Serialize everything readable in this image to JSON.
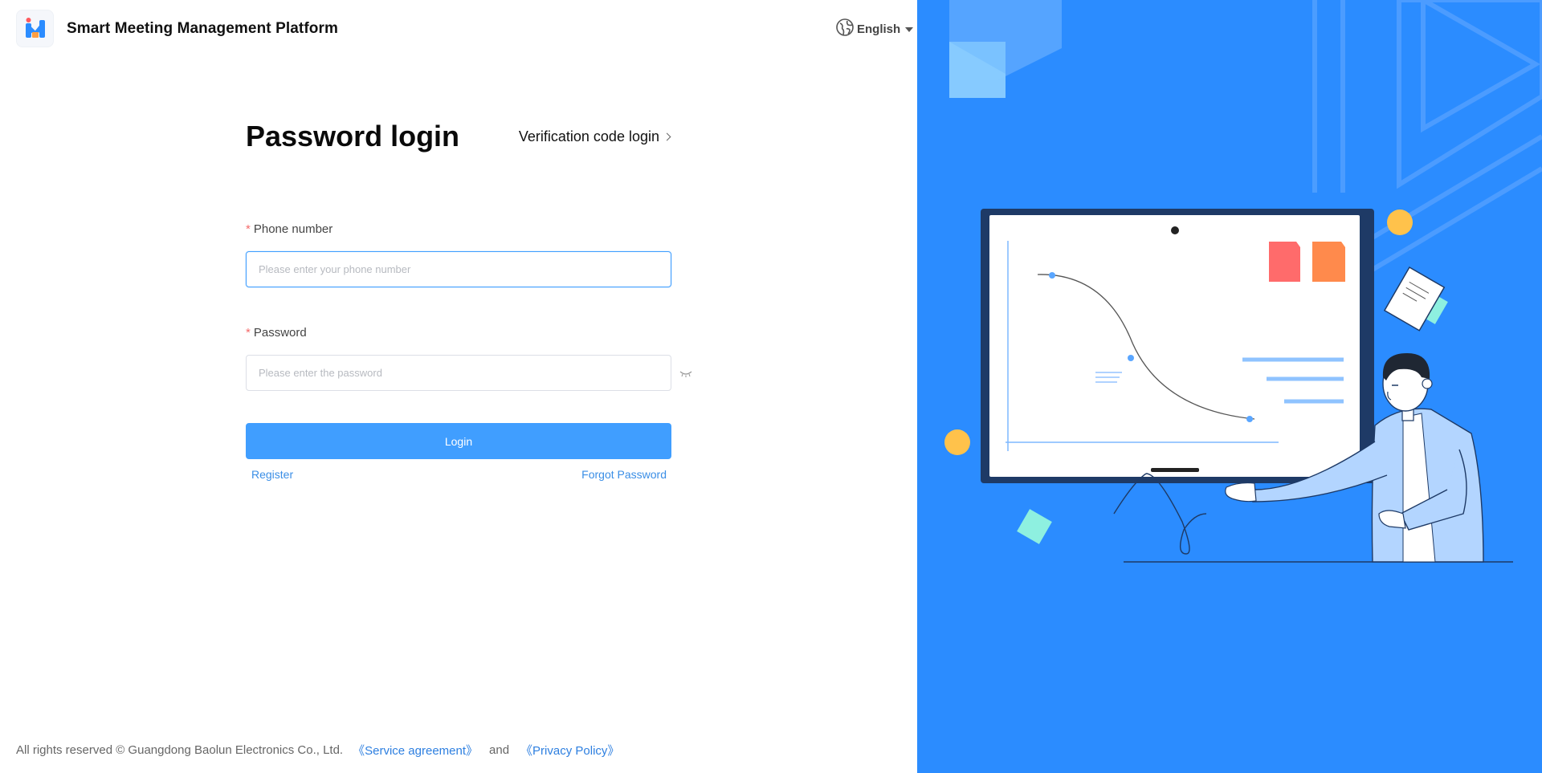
{
  "app": {
    "title": "Smart Meeting Management Platform"
  },
  "language": {
    "selected": "English",
    "icon": "globe-icon"
  },
  "login": {
    "title": "Password login",
    "switch_label": "Verification code login",
    "phone": {
      "label": "Phone number",
      "required_mark": "*",
      "placeholder": "Please enter your phone number",
      "value": ""
    },
    "password": {
      "label": "Password",
      "required_mark": "*",
      "placeholder": "Please enter the password",
      "value": "",
      "toggle_icon": "eye-closed-icon"
    },
    "submit_label": "Login",
    "register_label": "Register",
    "forgot_label": "Forgot Password"
  },
  "footer": {
    "copyright": "All rights reserved © Guangdong Baolun Electronics Co., Ltd.",
    "service_agreement": "《Service agreement》",
    "and": "and",
    "privacy_policy": "《Privacy Policy》"
  },
  "colors": {
    "accent": "#409eff",
    "link": "#3a8ee6",
    "required": "#f56c6c",
    "panel_background": "#2b8cff"
  }
}
